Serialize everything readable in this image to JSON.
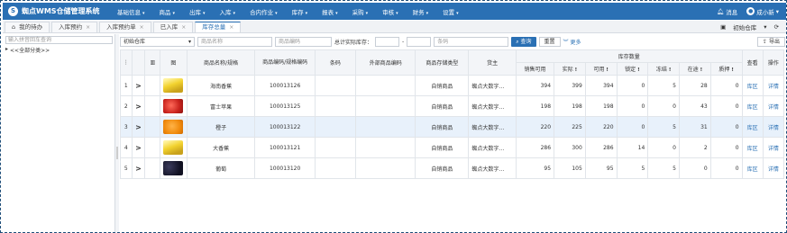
{
  "app": {
    "title": "蜘点WMS仓储管理系统",
    "logo_glyph": "S"
  },
  "menu": [
    "基础信息",
    "商品",
    "出库",
    "入库",
    "合内作业",
    "库存",
    "报表",
    "采购",
    "审核",
    "财务",
    "设置"
  ],
  "top_right": {
    "notifications": "消息",
    "user": "成小新"
  },
  "tabs": [
    {
      "label": "我的待办",
      "closable": false,
      "active": false
    },
    {
      "label": "入库预约",
      "closable": true,
      "active": false
    },
    {
      "label": "入库预约单",
      "closable": true,
      "active": false
    },
    {
      "label": "已入库",
      "closable": true,
      "active": false
    },
    {
      "label": "库存总量",
      "closable": true,
      "active": true
    }
  ],
  "tabstrip_right": {
    "warehouse": "初始仓库"
  },
  "left": {
    "search_placeholder": "输入拼音回车查询",
    "tree_root": "<<全部分类>>"
  },
  "toolbar": {
    "warehouse_select": "初始仓库",
    "name_placeholder": "商品名称",
    "code_placeholder": "商品编码",
    "qty_label": "总计实际库存：",
    "qty_sep": "-",
    "barcode_placeholder": "条码",
    "search_label": "查询",
    "reset_label": "重置",
    "more_label": "更多",
    "export_label": "导出"
  },
  "table": {
    "headers": {
      "image": "图",
      "name": "商品名称/规格",
      "code": "商品编码/规格编码",
      "barcode": "条码",
      "ext_code": "外部商品编码",
      "type": "商品存储类型",
      "owner": "货主",
      "stock_group": "库存数量",
      "sell": "销售可用",
      "actual": "实际",
      "avail": "可用",
      "locked": "锁定",
      "frozen": "冻结",
      "transit": "在途",
      "damaged": "质押",
      "view": "查看",
      "ops": "操作"
    },
    "rows": [
      {
        "idx": "1",
        "fruit": "banana",
        "name": "海南香蕉",
        "code": "100013126",
        "type": "自销商品",
        "owner": "蜘点大数字…",
        "sell": "394",
        "actual": "399",
        "avail": "394",
        "locked": "0",
        "frozen": "5",
        "transit": "28",
        "damaged": "0",
        "view": "库区",
        "op": "详情"
      },
      {
        "idx": "2",
        "fruit": "apple",
        "name": "富士苹果",
        "code": "100013125",
        "type": "自销商品",
        "owner": "蜘点大数字…",
        "sell": "198",
        "actual": "198",
        "avail": "198",
        "locked": "0",
        "frozen": "0",
        "transit": "43",
        "damaged": "0",
        "view": "库区",
        "op": "详情"
      },
      {
        "idx": "3",
        "fruit": "orange",
        "name": "橙子",
        "code": "100013122",
        "type": "自销商品",
        "owner": "蜘点大数字…",
        "sell": "220",
        "actual": "225",
        "avail": "220",
        "locked": "0",
        "frozen": "5",
        "transit": "31",
        "damaged": "0",
        "view": "库区",
        "op": "详情"
      },
      {
        "idx": "4",
        "fruit": "banana",
        "name": "大香蕉",
        "code": "100013121",
        "type": "自销商品",
        "owner": "蜘点大数字…",
        "sell": "286",
        "actual": "300",
        "avail": "286",
        "locked": "14",
        "frozen": "0",
        "transit": "2",
        "damaged": "0",
        "view": "库区",
        "op": "详情"
      },
      {
        "idx": "5",
        "fruit": "grape",
        "name": "葡萄",
        "code": "100013120",
        "type": "自销商品",
        "owner": "蜘点大数字…",
        "sell": "95",
        "actual": "105",
        "avail": "95",
        "locked": "5",
        "frozen": "5",
        "transit": "0",
        "damaged": "0",
        "view": "库区",
        "op": "详情"
      }
    ]
  },
  "colors": {
    "primary": "#2a70b4",
    "highlight_row": "#e8f1fb"
  }
}
